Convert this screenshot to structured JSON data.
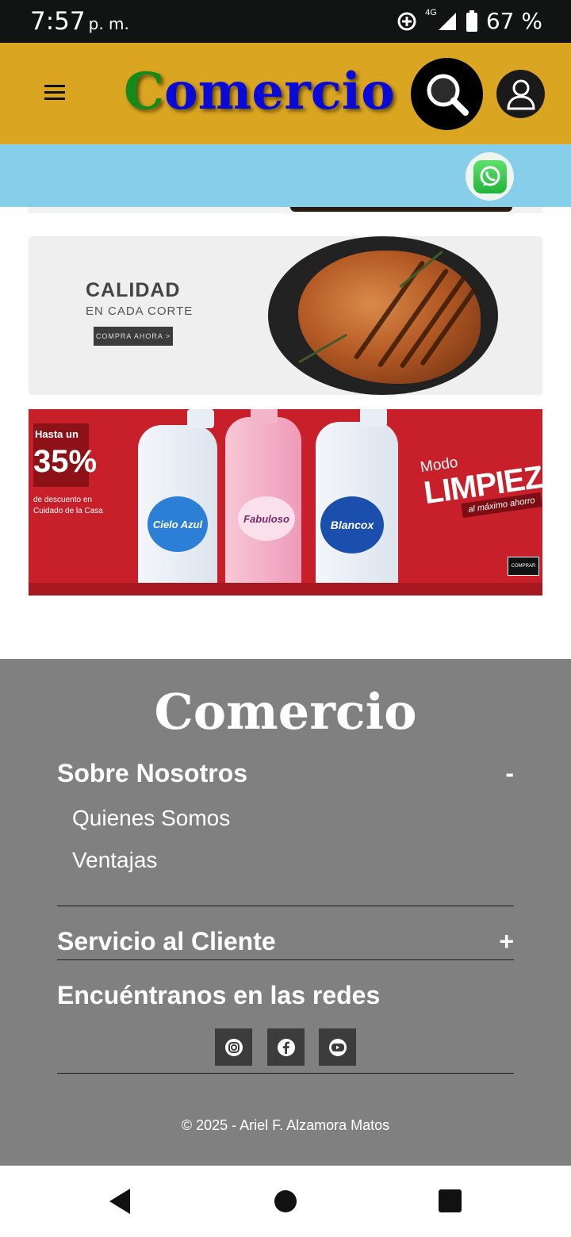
{
  "status_bar": {
    "time": "7:57",
    "time_suffix": "p. m.",
    "network": "4G",
    "battery": "67 %"
  },
  "header": {
    "logo_first": "C",
    "logo_rest": "omercio",
    "icons": [
      "menu-icon",
      "search-icon",
      "user-icon"
    ]
  },
  "contact": {
    "icon": "whatsapp-icon"
  },
  "banners": {
    "calidad": {
      "title": "CALIDAD",
      "subtitle": "EN CADA CORTE",
      "button": "COMPRA AHORA >"
    },
    "limpieza": {
      "promo_prefix": "Hasta un",
      "promo_value": "35%",
      "promo_desc": "de descuento en Cuidado de la Casa",
      "modo": "Modo",
      "title": "LIMPIEZA",
      "tagline": "al máximo ahorro",
      "buy": "COMPRAR",
      "products": [
        "Cielo Azul",
        "Fabuloso",
        "Blancox"
      ]
    }
  },
  "footer": {
    "logo": "Comercio",
    "about": {
      "title": "Sobre Nosotros",
      "toggle": "-",
      "links": [
        "Quienes Somos",
        "Ventajas"
      ]
    },
    "service": {
      "title": "Servicio al Cliente",
      "toggle": "+"
    },
    "social": {
      "title": "Encuéntranos en las redes",
      "icons": [
        "instagram-icon",
        "facebook-icon",
        "youtube-icon"
      ]
    },
    "copyright": "© 2025 - Ariel F. Alzamora Matos"
  },
  "navbar": {
    "icons": [
      "back-icon",
      "home-icon",
      "recents-icon"
    ]
  },
  "colors": {
    "header_bg": "#DAA520",
    "strip_bg": "#87CEEB",
    "footer_bg": "#808080",
    "logo_green": "#138a1a",
    "logo_blue": "#0a0ad8",
    "promo_red": "#c7202a"
  }
}
